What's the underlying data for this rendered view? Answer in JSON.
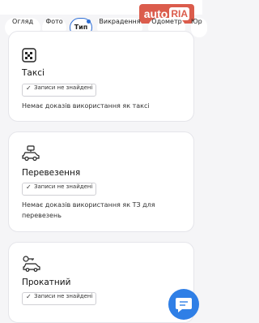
{
  "header": {
    "logo_auto": "auto",
    "logo_ria": "RIA"
  },
  "tabs": [
    {
      "label": "Огляд"
    },
    {
      "label": "Фото"
    },
    {
      "label": "Тип"
    },
    {
      "label": "Викрадення"
    },
    {
      "label": "Одометр"
    },
    {
      "label": "Юр"
    }
  ],
  "cards": [
    {
      "title": "Таксі",
      "status": "Записи не знайдені",
      "description": "Немає доказів використання як таксі"
    },
    {
      "title": "Перевезення",
      "status": "Записи не знайдені",
      "description": "Немає доказів використання як ТЗ для перевезень"
    },
    {
      "title": "Прокатний",
      "status": "Записи не знайдені"
    }
  ]
}
